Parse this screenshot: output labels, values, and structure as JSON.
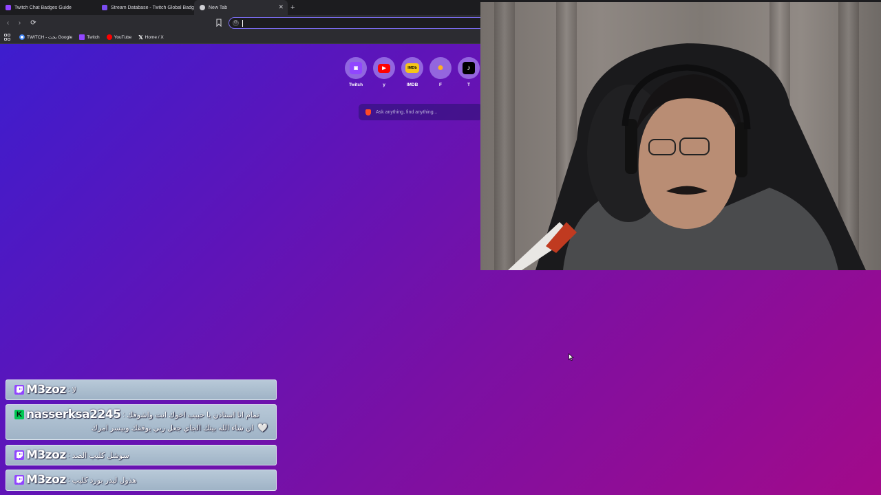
{
  "browser": {
    "tabs": [
      {
        "label": "Twitch Chat Badges Guide",
        "icon": "twitch-favicon",
        "color": "#9146ff"
      },
      {
        "label": "Stream Database - Twitch Global Badges",
        "icon": "stream-database-favicon",
        "color": "#7a4cf0"
      },
      {
        "label": "New Tab",
        "icon": "brave-favicon",
        "color": "#ffffff"
      }
    ],
    "close_glyph": "✕",
    "new_tab_glyph": "+",
    "nav": {
      "back": "‹",
      "forward": "›",
      "reload": "⟳"
    },
    "omnibox": {
      "engine_icon": "G",
      "value": "",
      "placeholder": ""
    },
    "bookmarks": [
      {
        "label": "TWITCH - بحث Google",
        "icon": "google-icon",
        "color": "#ffffff"
      },
      {
        "label": "Twitch",
        "icon": "twitch-icon",
        "color": "#9146ff"
      },
      {
        "label": "YouTube",
        "icon": "youtube-icon",
        "color": "#ff0000"
      },
      {
        "label": "Home / X",
        "icon": "x-icon",
        "color": "#000000"
      }
    ]
  },
  "newtab": {
    "shortcuts": [
      {
        "label": "Twitch",
        "glyph": "▣",
        "bg": "#9146ff",
        "fg": "#ffffff"
      },
      {
        "label": "y",
        "glyph": "▶",
        "bg": "#ff0000",
        "fg": "#ffffff"
      },
      {
        "label": "IMDB",
        "glyph": "IMDb",
        "bg": "#f5c518",
        "fg": "#000000"
      },
      {
        "label": "F",
        "glyph": "●",
        "bg": "#ffb020",
        "fg": "#ffb020"
      },
      {
        "label": "T",
        "glyph": "♪",
        "bg": "#000000",
        "fg": "#ffffff"
      }
    ],
    "ask_placeholder": "Ask anything, find anything..."
  },
  "chat": {
    "messages": [
      {
        "user": "M3zoz",
        "sep": ":",
        "text": "لا",
        "badge_color": "#9146ff",
        "line2": ""
      },
      {
        "user": "nasserksa2245",
        "sep": ":",
        "text": "تمام انا استاذن يا حبيب اخوك انت واشوفك",
        "badge_color": "#00c853",
        "line2": "ان شاء الله بيتك الجاي جعل ربي يوفقك وبيسر امرك",
        "heart": "🤍"
      },
      {
        "user": "M3zoz",
        "sep": ":",
        "text": "سوشل كليب الصد",
        "badge_color": "#9146ff",
        "line2": ""
      },
      {
        "user": "M3zoz",
        "sep": ":",
        "text": "هذول ليدر بورد كليب",
        "badge_color": "#9146ff",
        "line2": ""
      }
    ]
  }
}
